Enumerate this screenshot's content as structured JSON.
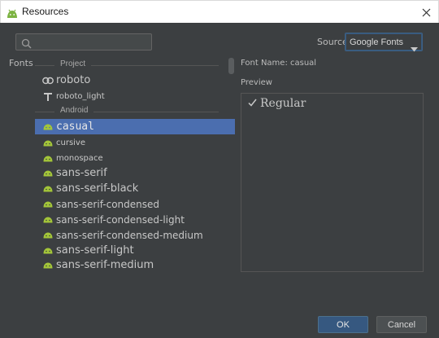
{
  "window": {
    "title": "Resources",
    "close_icon": "close-icon"
  },
  "search": {
    "placeholder": "",
    "value": ""
  },
  "source": {
    "label": "Source:",
    "selected": "Google Fonts"
  },
  "fonts_label": "Fonts",
  "groups": {
    "project": "Project",
    "android": "Android"
  },
  "items": [
    {
      "label": "roboto",
      "icon": "link-icon"
    },
    {
      "label": "roboto_light",
      "icon": "text-t-icon"
    },
    {
      "label": "casual",
      "icon": "android-icon"
    },
    {
      "label": "cursive",
      "icon": "android-icon"
    },
    {
      "label": "monospace",
      "icon": "android-icon"
    },
    {
      "label": "sans-serif",
      "icon": "android-icon"
    },
    {
      "label": "sans-serif-black",
      "icon": "android-icon"
    },
    {
      "label": "sans-serif-condensed",
      "icon": "android-icon"
    },
    {
      "label": "sans-serif-condensed-light",
      "icon": "android-icon"
    },
    {
      "label": "sans-serif-condensed-medium",
      "icon": "android-icon"
    },
    {
      "label": "sans-serif-light",
      "icon": "android-icon"
    },
    {
      "label": "sans-serif-medium",
      "icon": "android-icon"
    }
  ],
  "selected_item": "casual",
  "detail": {
    "font_name_label": "Font Name: casual",
    "preview_label": "Preview",
    "preview_item": "Regular"
  },
  "buttons": {
    "ok": "OK",
    "cancel": "Cancel"
  },
  "colors": {
    "accent": "#4b6eaf",
    "android_green": "#a4c639",
    "background": "#3c3f41"
  }
}
